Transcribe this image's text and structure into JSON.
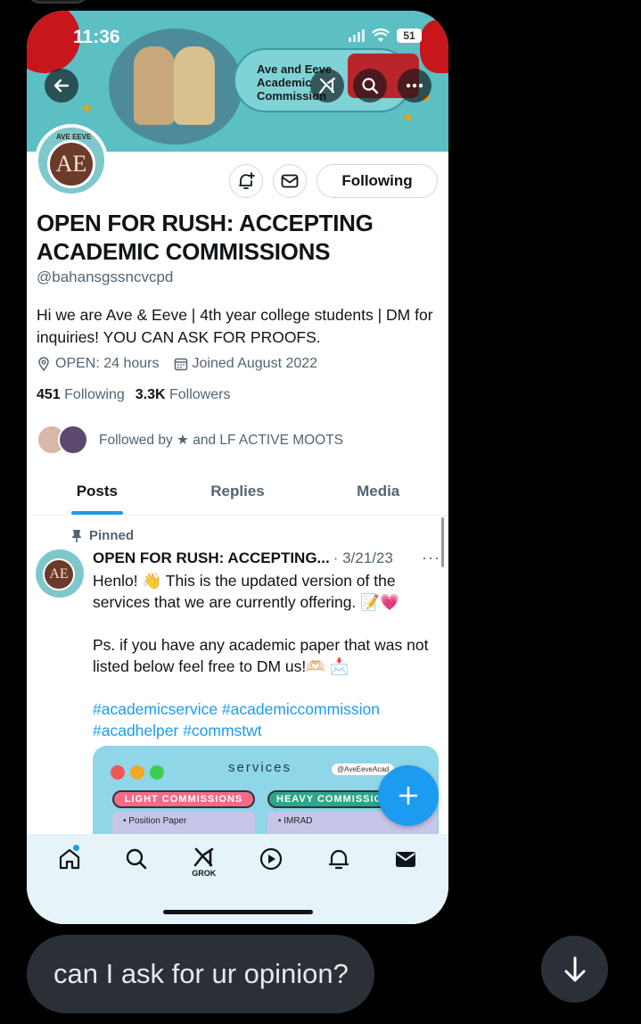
{
  "status_bar": {
    "time": "11:36",
    "battery": "51"
  },
  "banner": {
    "title": "Ave and Eeve Academic Commission"
  },
  "profile": {
    "avatar_monogram": "AE",
    "avatar_caption": "AVE EEVE",
    "follow_label": "Following",
    "name": "OPEN FOR RUSH: ACCEPTING ACADEMIC COMMISSIONS",
    "handle": "@bahansgssncvcpd",
    "bio": "Hi we are Ave & Eeve | 4th year college students | DM for inquiries! YOU CAN ASK FOR PROOFS.",
    "location": "OPEN: 24 hours",
    "joined": "Joined August 2022",
    "following_count": "451",
    "following_label": "Following",
    "followers_count": "3.3K",
    "followers_label": "Followers",
    "followed_by": "Followed by ★ and LF ACTIVE MOOTS"
  },
  "tabs": [
    {
      "label": "Posts",
      "active": true
    },
    {
      "label": "Replies",
      "active": false
    },
    {
      "label": "Media",
      "active": false
    }
  ],
  "post": {
    "pinned_label": "Pinned",
    "author": "OPEN FOR RUSH: ACCEPTING...",
    "date": "· 3/21/23",
    "more": "···",
    "line1": "Henlo! 👋 This is the updated version of the services that we are currently offering. 📝💗",
    "line2": "Ps. if you have any academic paper that was not listed below feel free to DM us!🫶🏻 📩",
    "hashtags": "#academicservice #academiccommission #acadhelper #commstwt",
    "media": {
      "heading": "services",
      "tag": "@AveEeveAcad",
      "light": "LIGHT COMMISSIONS",
      "heavy": "HEAVY COMMISSIONS",
      "light_item": "• Position Paper",
      "heavy_item": "• IMRAD"
    }
  },
  "nav": {
    "grok_label": "GROK"
  },
  "chat": {
    "message": "can I ask for ur opinion?"
  },
  "colors": {
    "accent": "#1d9bf0",
    "banner": "#5bbfc4",
    "chat_bubble": "#2b3036"
  }
}
